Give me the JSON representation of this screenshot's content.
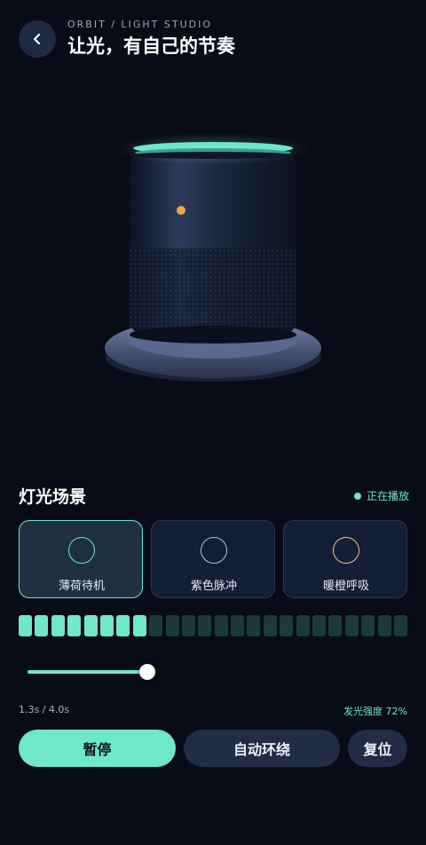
{
  "header": {
    "eyebrow": "ORBIT / LIGHT STUDIO",
    "title": "让光，有自己的节奏",
    "back_icon": "chevron-left-icon"
  },
  "scene_section": {
    "title": "灯光场景",
    "status": "正在播放",
    "scenes": [
      {
        "label": "薄荷待机",
        "ring_color": "#6fe8c8",
        "active": true
      },
      {
        "label": "紫色脉冲",
        "ring_color": "#b6c0dd",
        "active": false
      },
      {
        "label": "暖橙呼吸",
        "ring_color": "#f2c27a",
        "active": false
      }
    ]
  },
  "level_meter": {
    "segments_total": 24,
    "segments_lit": 8,
    "lit_color": "#6fe8c8",
    "unlit_color": "#1d3a3a"
  },
  "playback": {
    "progress_fraction": 0.33,
    "time_text": "1.3s / 4.0s",
    "intensity_text": "发光强度 72%"
  },
  "actions": {
    "pause_label": "暂停",
    "orbit_label": "自动环绕",
    "reset_label": "复位"
  },
  "colors": {
    "accent": "#6fe8c8",
    "background": "#080c16",
    "indicator_led": "#e8a94a"
  }
}
